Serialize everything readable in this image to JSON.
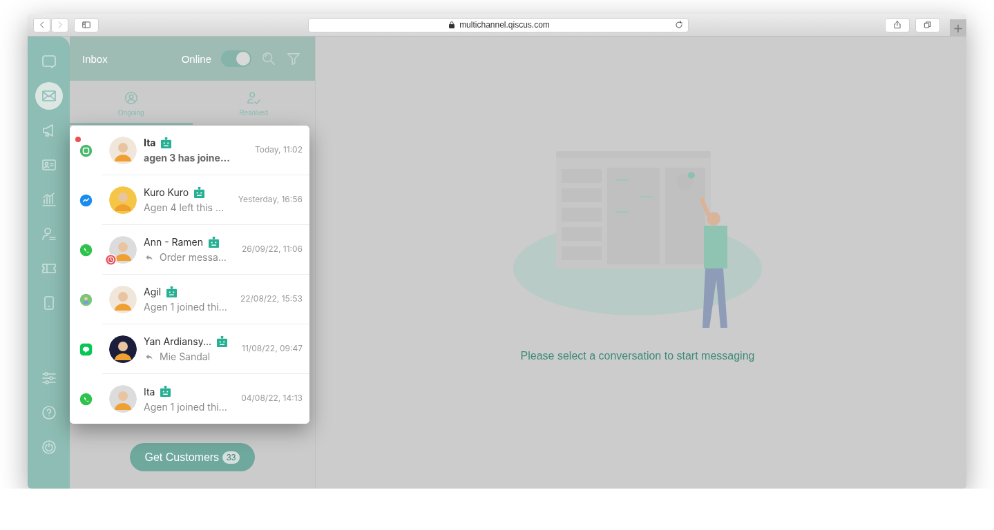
{
  "browser": {
    "url": "multichannel.qiscus.com",
    "new_tab": "+"
  },
  "rail": {
    "items": [
      {
        "kind": "chat",
        "selected": false
      },
      {
        "kind": "inbox",
        "selected": true
      },
      {
        "kind": "broadcast",
        "selected": false
      },
      {
        "kind": "contacts",
        "selected": false
      },
      {
        "kind": "analytics",
        "selected": false
      },
      {
        "kind": "agents",
        "selected": false
      },
      {
        "kind": "tickets",
        "selected": false
      },
      {
        "kind": "mobile",
        "selected": false
      }
    ],
    "bottom_items": [
      {
        "kind": "settings",
        "selected": false
      },
      {
        "kind": "help",
        "selected": false
      },
      {
        "kind": "logout",
        "selected": false
      }
    ]
  },
  "inbox": {
    "title": "Inbox",
    "status_label": "Online",
    "online": true,
    "tabs": [
      {
        "kind": "ongoing",
        "label": "Ongoing",
        "selected": true
      },
      {
        "kind": "resolved",
        "label": "Resolved",
        "selected": false
      }
    ],
    "conversations": [
      {
        "kind": "qiscus",
        "unread": true,
        "name": "Ita",
        "bot": true,
        "replied": false,
        "overdue": false,
        "preview": "agen 3 has joine...",
        "time": "Today, 11:02"
      },
      {
        "kind": "messenger",
        "unread": false,
        "name": "Kuro Kuro",
        "bot": true,
        "replied": false,
        "overdue": false,
        "preview": "Agen 4 left this ...",
        "time": "Yesterday, 16:56"
      },
      {
        "kind": "whatsapp",
        "unread": false,
        "name": "Ann - Ramen",
        "bot": true,
        "replied": true,
        "overdue": true,
        "preview": "Order messa...",
        "time": "26/09/22, 11:06"
      },
      {
        "kind": "custom",
        "unread": false,
        "name": "Agil",
        "bot": true,
        "replied": false,
        "overdue": false,
        "preview": "Agen 1 joined thi...",
        "time": "22/08/22, 15:53"
      },
      {
        "kind": "line",
        "unread": false,
        "name": "Yan Ardiansy...",
        "bot": true,
        "replied": true,
        "overdue": false,
        "preview": "Mie Sandal",
        "time": "11/08/22, 09:47"
      },
      {
        "kind": "whatsapp",
        "unread": false,
        "name": "Ita",
        "bot": true,
        "replied": false,
        "overdue": false,
        "preview": "Agen 1 joined thi...",
        "time": "04/08/22, 14:13"
      }
    ],
    "get_customers": {
      "label": "Get Customers",
      "count": "33"
    }
  },
  "empty_state": {
    "message": "Please select a conversation to start messaging"
  }
}
